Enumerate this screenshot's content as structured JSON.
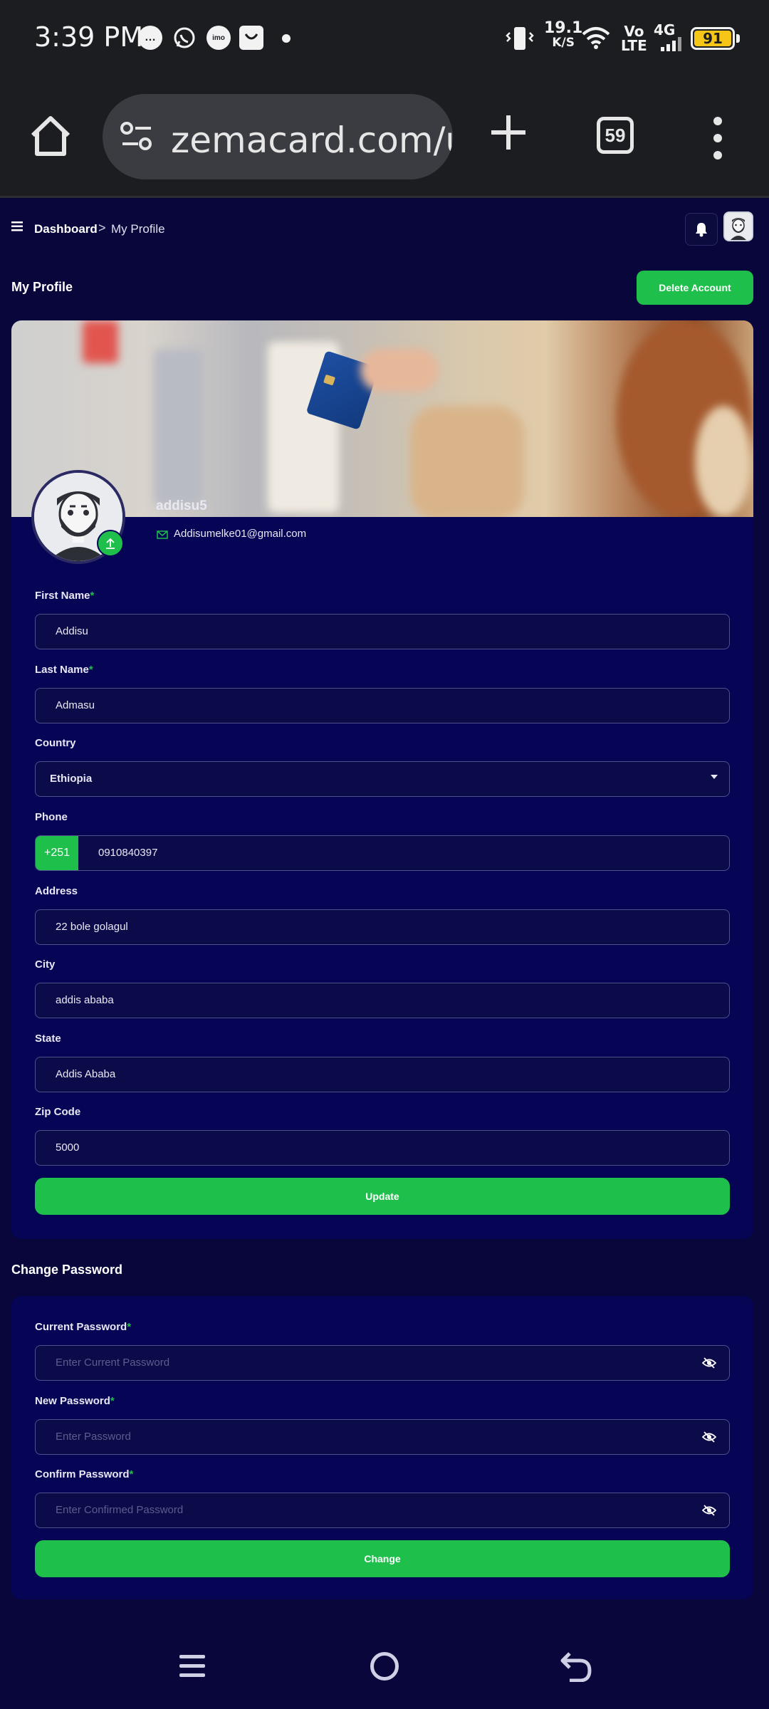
{
  "status_bar": {
    "time": "3:39 PM",
    "net_speed_value": "19.1",
    "net_speed_unit": "K/S",
    "volte_top": "Vo",
    "volte_bottom": "LTE",
    "network": "4G",
    "battery": "91",
    "icons": [
      "chat-icon",
      "whatsapp-icon",
      "imo-icon",
      "shop-icon",
      "vibrate-icon",
      "wifi-icon",
      "signal-icon",
      "battery-icon"
    ]
  },
  "browser": {
    "url": "zemacard.com/us",
    "tab_count": "59",
    "icons": [
      "home-icon",
      "site-settings-icon",
      "new-tab-icon",
      "tabs-icon",
      "menu-icon"
    ]
  },
  "header": {
    "breadcrumb_root": "Dashboard",
    "breadcrumb_separator": ">",
    "breadcrumb_current": "My Profile"
  },
  "page": {
    "title": "My Profile",
    "delete_label": "Delete Account"
  },
  "profile": {
    "username": "addisu5",
    "email": "Addisumelke01@gmail.com"
  },
  "form": {
    "first_name": {
      "label": "First Name",
      "value": "Addisu"
    },
    "last_name": {
      "label": "Last Name",
      "value": "Admasu"
    },
    "country": {
      "label": "Country",
      "value": "Ethiopia"
    },
    "phone": {
      "label": "Phone",
      "prefix": "+251",
      "value": "0910840397"
    },
    "address": {
      "label": "Address",
      "value": "22 bole golagul"
    },
    "city": {
      "label": "City",
      "value": "addis ababa"
    },
    "state": {
      "label": "State",
      "value": "Addis Ababa"
    },
    "zip": {
      "label": "Zip Code",
      "value": "5000"
    },
    "required_mark": "*",
    "update_label": "Update"
  },
  "password": {
    "section_title": "Change Password",
    "current": {
      "label": "Current Password",
      "placeholder": "Enter Current Password"
    },
    "new": {
      "label": "New Password",
      "placeholder": "Enter Password"
    },
    "confirm": {
      "label": "Confirm Password",
      "placeholder": "Enter Confirmed Password"
    },
    "change_label": "Change"
  },
  "colors": {
    "background": "#08063a",
    "card": "#060455",
    "accent": "#1fbf4c",
    "chrome": "#1b1d21"
  }
}
